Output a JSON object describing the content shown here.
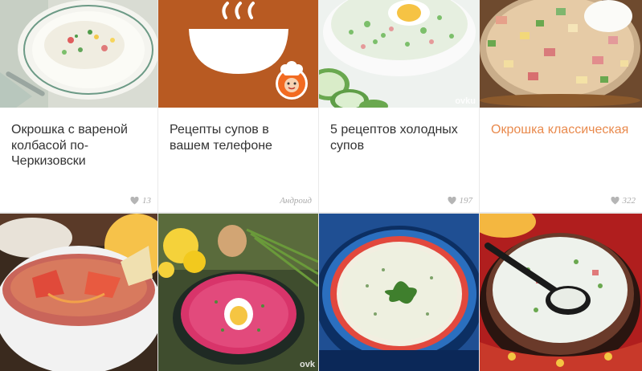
{
  "cards": [
    {
      "title": "Окрошка с вареной колбасой по-Черкизовски",
      "likes": "13"
    },
    {
      "title": "Рецепты супов в вашем телефоне",
      "source": "Андроид"
    },
    {
      "title": "5 рецептов холодных супов",
      "likes": "197",
      "watermark": "ovku"
    },
    {
      "title": "Окрошка классическая",
      "likes": "322"
    }
  ],
  "bottom_row": [
    {
      "watermark": ""
    },
    {
      "watermark": "ovk"
    },
    {
      "watermark": ""
    },
    {
      "watermark": ""
    }
  ],
  "colors": {
    "accent": "#e98a4d",
    "title_text": "#333333",
    "meta_text": "#aaaaaa",
    "app_banner": "#b85a22"
  },
  "icons": {
    "like": "heart-icon",
    "app": "soup-bowl-icon",
    "chef": "chef-mascot-icon"
  }
}
